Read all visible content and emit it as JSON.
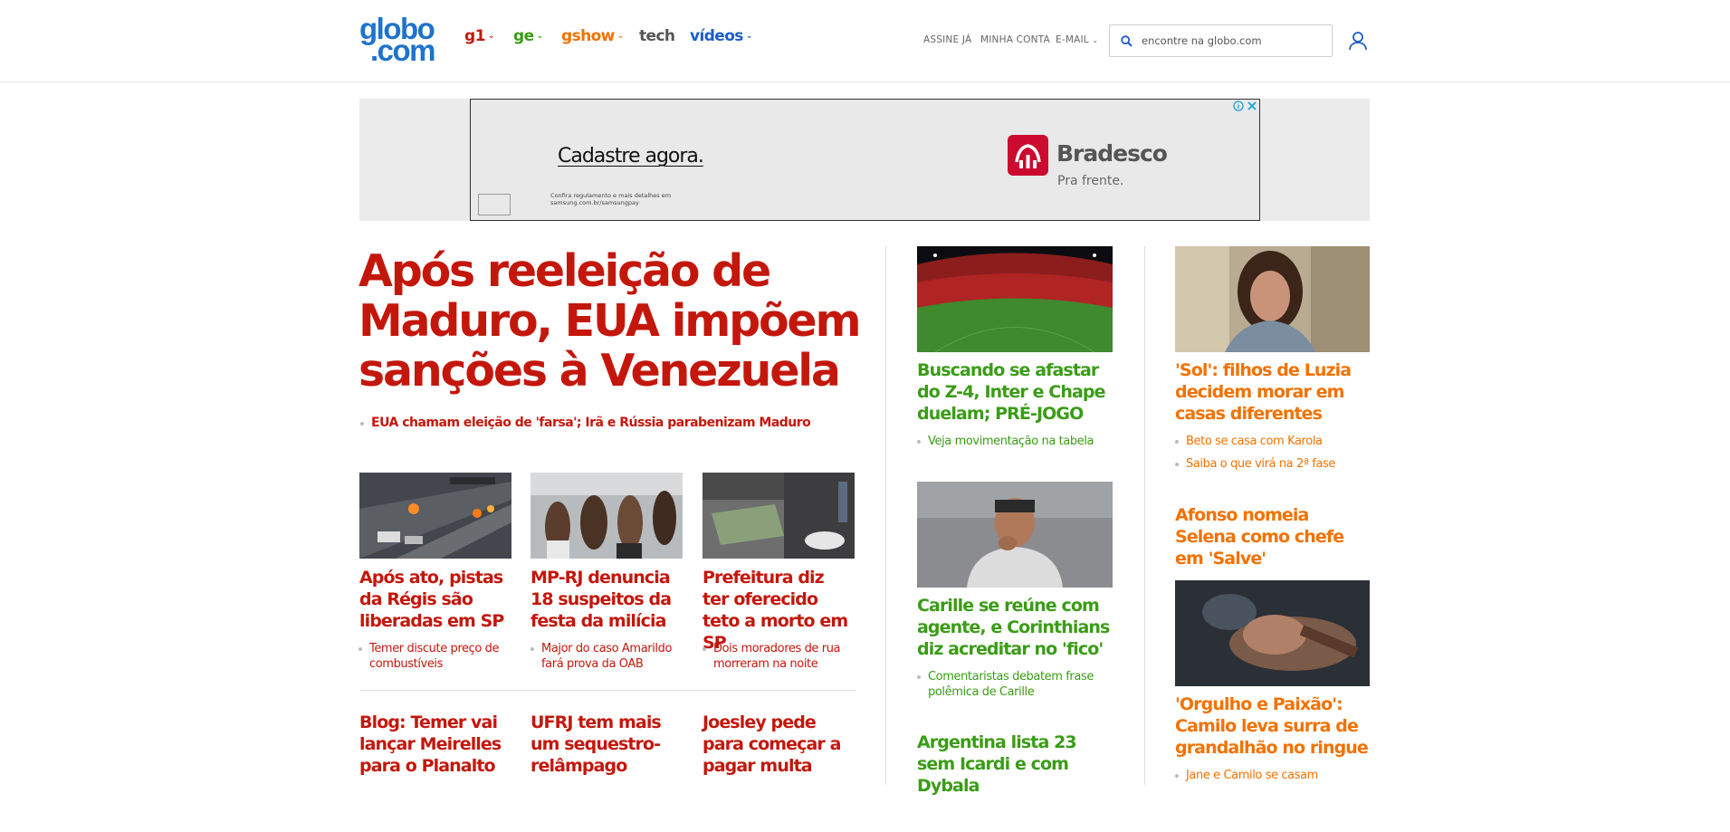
{
  "header": {
    "logo_line1": "globo",
    "logo_line2": ".com",
    "nav": [
      {
        "label": "g1",
        "color": "#c4170c"
      },
      {
        "label": "ge",
        "color": "#3a9c16"
      },
      {
        "label": "gshow",
        "color": "#f27200"
      },
      {
        "label": "tech",
        "color": "#555555"
      },
      {
        "label": "vídeos",
        "color": "#1e5bc6"
      }
    ],
    "links": {
      "subscribe": "ASSINE JÁ",
      "account": "MINHA CONTA",
      "email": "E-MAIL"
    },
    "search_placeholder": "encontre na globo.com",
    "icons": {
      "search": "search-icon",
      "user": "user-icon",
      "chevron": "chevron-down-icon"
    }
  },
  "ad": {
    "headline": "Cadastre agora.",
    "brand": "Bradesco",
    "tagline": "Pra frente.",
    "fine_print": "Confira regulamento e mais detalhes em samsung.com.br/samsungpay",
    "icons": {
      "info": "adchoices-icon",
      "close": "close-icon"
    }
  },
  "news": {
    "main_headline": "Após reeleição de Maduro, EUA impõem sanções à Venezuela",
    "main_sub": "EUA chamam eleição de 'farsa'; Irã e Rússia parabenizam Maduro",
    "stories": [
      {
        "headline": "Após ato, pistas da Régis são liberadas em SP",
        "sub": "Temer discute preço de combustíveis"
      },
      {
        "headline": "MP-RJ denuncia 18 suspeitos da festa da milícia",
        "sub": "Major do caso Amarildo fará prova da OAB"
      },
      {
        "headline": "Prefeitura diz ter oferecido teto a morto em SP",
        "sub": "Dois moradores de rua morreram na noite"
      }
    ],
    "more": [
      {
        "headline": "Blog: Temer vai lançar Meirelles para o Planalto"
      },
      {
        "headline": "UFRJ tem mais um sequestro-relâmpago"
      },
      {
        "headline": "Joesley pede para começar a pagar multa"
      }
    ]
  },
  "sports": {
    "s1": {
      "headline": "Buscando se afastar do Z-4, Inter e Chape duelam; PRÉ-JOGO",
      "sub": "Veja movimentação na tabela"
    },
    "s2": {
      "headline": "Carille se reúne com agente, e Corinthians diz acreditar no 'fico'",
      "sub": "Comentaristas debatem frase polêmica de Carille"
    },
    "s3": {
      "headline": "Argentina lista 23 sem Icardi e com Dybala"
    }
  },
  "entertainment": {
    "e1": {
      "headline": "'Sol': filhos de Luzia decidem morar em casas diferentes",
      "subs": [
        "Beto se casa com Karola",
        "Saiba o que virá na 2ª fase"
      ]
    },
    "e2": {
      "headline": "Afonso nomeia Selena como chefe em 'Salve'"
    },
    "e3": {
      "headline": "'Orgulho e Paixão': Camilo leva surra de grandalhão no ringue",
      "sub": "Jane e Camilo se casam"
    }
  },
  "colors": {
    "news": "#c4170c",
    "sports": "#3a9c16",
    "entertainment": "#f27200",
    "brand": "#1e73cc"
  }
}
